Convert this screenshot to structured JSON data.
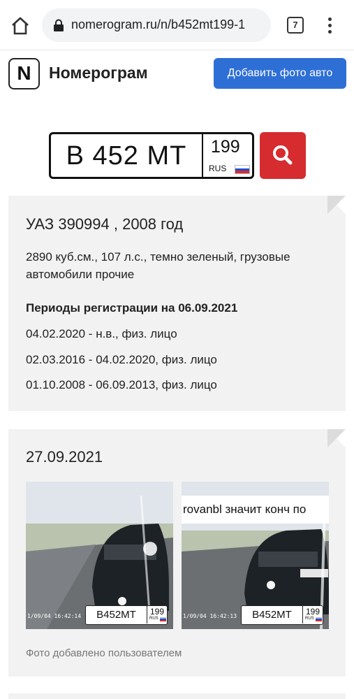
{
  "browser": {
    "url": "nomerogram.ru/n/b452mt199-1",
    "tab_count": "7"
  },
  "header": {
    "logo_letter": "N",
    "brand": "Номерограм",
    "add_photo_label": "Добавить фото авто"
  },
  "search": {
    "plate_main": "В 452 МТ",
    "plate_region": "199",
    "plate_country": "RUS"
  },
  "car": {
    "title": "УАЗ 390994 , 2008 год",
    "specs": "2890 куб.см., 107 л.с., темно зеленый, грузовые автомобили прочие",
    "periods_title": "Периоды регистрации на 06.09.2021",
    "periods": [
      "04.02.2020 - н.в., физ. лицо",
      "02.03.2016 - 04.02.2020, физ. лицо",
      "01.10.2008 - 06.09.2013, физ. лицо"
    ]
  },
  "photos": {
    "date": "27.09.2021",
    "items": [
      {
        "timestamp": "1/09/04 16:42:14",
        "caption": "",
        "plate_main": "В452МТ",
        "plate_region": "199",
        "plate_country": "RUS"
      },
      {
        "timestamp": "1/09/04 16:42:13",
        "caption": "rovanbl значит конч по",
        "plate_main": "В452МТ",
        "plate_region": "199",
        "plate_country": "RUS"
      }
    ],
    "credit": "Фото добавлено пользователем"
  },
  "colors": {
    "accent_blue": "#2e6fd6",
    "search_red": "#d62c30",
    "card_bg": "#f2f2f2",
    "flag": [
      "#ffffff",
      "#1d4fd6",
      "#d62c30"
    ]
  }
}
